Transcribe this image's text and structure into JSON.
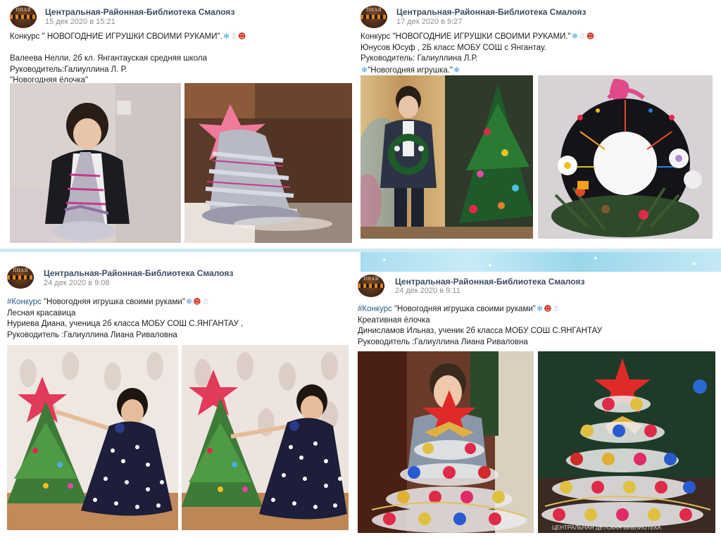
{
  "group_name": "Центральная-Районная-Библиотека Смалояз",
  "avatar_text": "ПНАЯ",
  "posts": [
    {
      "date": "15 дек 2020 в 15:21",
      "lines": [
        "Конкурс \" НОВОГОДНИЕ ИГРУШКИ СВОИМИ РУКАМИ\".",
        "",
        "Валеева Нелли, 2б кл. Янгантауская средняя школа",
        "Руководитель:Галиуллина Л. Р.",
        "\"Новогодняя ёлочка\""
      ]
    },
    {
      "date": "17 дек 2020 в 9:27",
      "lines": [
        "Конкурс \"НОВОГОДНИЕ ИГРУШКИ СВОИМИ РУКАМИ.\"",
        "Юнусов Юсуф , 2Б класс МОБУ СОШ с Янгантау.",
        "Руководитель: Галиуллина Л.Р.",
        "\"Новогодняя игрушка.\""
      ]
    },
    {
      "date": "24 дек 2020 в 9:08",
      "hashtag": "#Конкурс",
      "lines": [
        " \"Новогодняя игрушка своими руками\"",
        "Лесная красавица",
        "Нуриева Диана, ученица 2б класса МОБУ СОШ С.ЯНГАНТАУ ,",
        "Руководитель :Галиуллина Лиана Риваловна"
      ]
    },
    {
      "date": "24 дек 2020 в 9:11",
      "hashtag": "#Конкурс",
      "lines": [
        " \"Новогодняя игрушка своими руками\"",
        "Креативная ёлочка",
        "Динисламов Ильназ, ученик 2б класса МОБУ СОШ С.ЯНГАНТАУ",
        "Руководитель :Галиуллина Лиана Риваловна"
      ]
    }
  ],
  "emoji": {
    "snowflake": "❄",
    "snowman": "☃",
    "santa": "☻"
  },
  "photos": [
    {
      "name": "photo-girl-with-tree"
    },
    {
      "name": "photo-silver-tree-star"
    },
    {
      "name": "photo-boy-with-wreath"
    },
    {
      "name": "photo-wreath-closeup"
    },
    {
      "name": "photo-girl-polka-dress-1"
    },
    {
      "name": "photo-girl-polka-dress-2"
    },
    {
      "name": "photo-boy-cup-tree"
    },
    {
      "name": "photo-cup-tree-closeup"
    }
  ],
  "watermark": "ЦЕНТРАЛЬНАЯ ДЕТСКАЯ БИБЛИОТЕКА",
  "colors": {
    "group_name": "#3a4b63",
    "date": "#8a8f96",
    "hashtag": "#2a5885"
  }
}
